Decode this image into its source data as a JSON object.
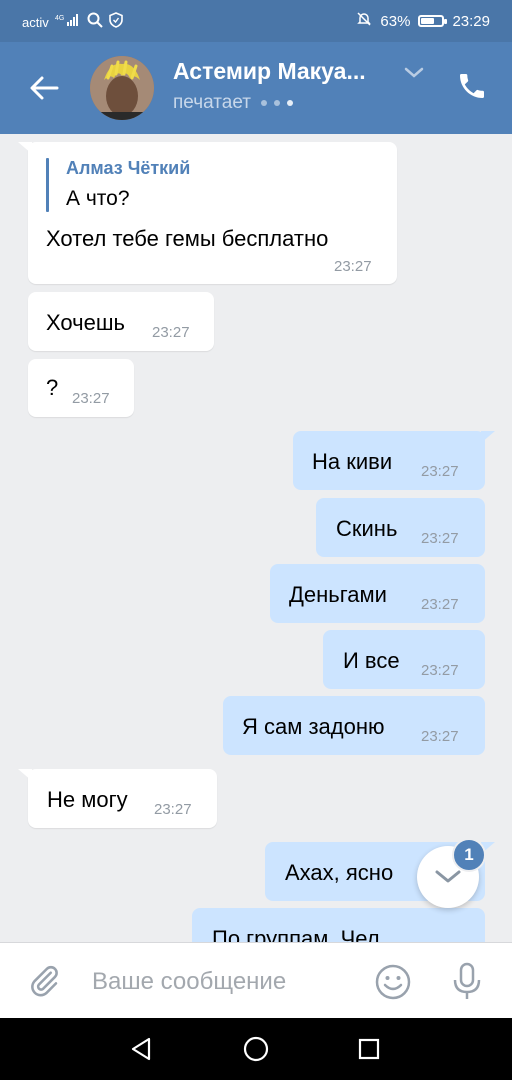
{
  "status_bar": {
    "carrier": "activ",
    "signal": "4G",
    "battery": "63%",
    "battery_level": 0.63,
    "time": "23:29"
  },
  "header": {
    "title": "Астемир Макуа...",
    "status": "печатает"
  },
  "messages": [
    {
      "dir": "in",
      "reply_name": "Алмаз Чёткий",
      "reply_text": "А что?",
      "text": "Хотел тебе гемы бесплатно",
      "time": "23:27"
    },
    {
      "dir": "in",
      "text": "Хочешь",
      "time": "23:27"
    },
    {
      "dir": "in",
      "text": "?",
      "time": "23:27"
    },
    {
      "dir": "out",
      "text": "На киви",
      "time": "23:27"
    },
    {
      "dir": "out",
      "text": "Скинь",
      "time": "23:27"
    },
    {
      "dir": "out",
      "text": "Деньгами",
      "time": "23:27"
    },
    {
      "dir": "out",
      "text": "И все",
      "time": "23:27"
    },
    {
      "dir": "out",
      "text": "Я сам задоню",
      "time": "23:27"
    },
    {
      "dir": "in",
      "text": "Не могу",
      "time": "23:27"
    },
    {
      "dir": "out",
      "text": "Ахах, ясно",
      "time": ""
    },
    {
      "dir": "out",
      "text": "По группам. Чел",
      "time": ""
    }
  ],
  "scroll_down": {
    "badge": "1"
  },
  "composer": {
    "placeholder": "Ваше сообщение"
  },
  "colors": {
    "header": "#5181b8",
    "status_bar": "#4a76a8",
    "outgoing": "#cce4ff",
    "incoming": "#ffffff",
    "background": "#edeef0"
  },
  "icons": [
    "back-arrow-icon",
    "chevron-down-icon",
    "phone-icon",
    "paperclip-icon",
    "emoji-icon",
    "microphone-icon",
    "chevron-down-icon",
    "nav-back-icon",
    "nav-home-icon",
    "nav-recents-icon"
  ]
}
